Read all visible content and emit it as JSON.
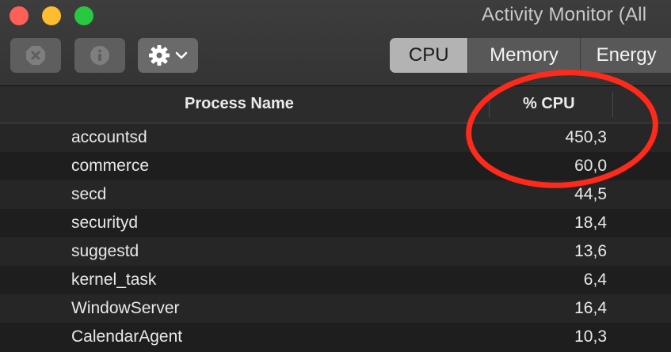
{
  "window": {
    "title": "Activity Monitor (All"
  },
  "toolbar": {
    "stop_icon": "stop-process-icon",
    "info_icon": "info-icon",
    "gear_icon": "gear-icon"
  },
  "tabs": [
    {
      "label": "CPU",
      "active": true
    },
    {
      "label": "Memory",
      "active": false
    },
    {
      "label": "Energy",
      "active": false
    }
  ],
  "table": {
    "columns": {
      "process_name": "Process Name",
      "cpu": "% CPU"
    },
    "rows": [
      {
        "name": "accountsd",
        "cpu": "450,3"
      },
      {
        "name": "commerce",
        "cpu": "60,0"
      },
      {
        "name": "secd",
        "cpu": "44,5"
      },
      {
        "name": "securityd",
        "cpu": "18,4"
      },
      {
        "name": "suggestd",
        "cpu": "13,6"
      },
      {
        "name": "kernel_task",
        "cpu": "6,4"
      },
      {
        "name": "WindowServer",
        "cpu": "16,4"
      },
      {
        "name": "CalendarAgent",
        "cpu": "10,3"
      }
    ]
  },
  "colors": {
    "annotation": "#ff2a1a",
    "close": "#fe5f57",
    "minimize": "#febc2e",
    "maximize": "#28c840"
  }
}
